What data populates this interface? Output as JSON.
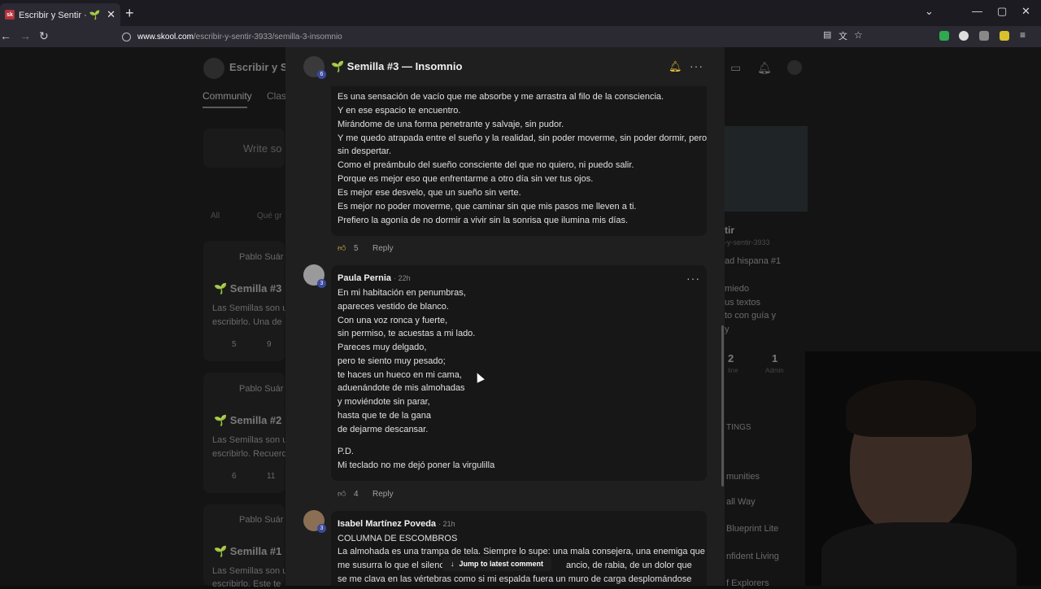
{
  "browser": {
    "tab_title": "Escribir y Sentir · 🌱 | Semillas",
    "tab_favicon": "sk",
    "url_domain": "www.skool.com",
    "url_path": "/escribir-y-sentir-3933/semilla-3-insomnio"
  },
  "background": {
    "community_name": "Escribir y Se",
    "tab_community": "Community",
    "tab_classroom": "Clas",
    "write_placeholder": "Write so",
    "filter_all": "All",
    "filter_other": "Qué gr",
    "posts": [
      {
        "author": "Pablo Suár",
        "title": "🌱 Semilla #3",
        "excerpt1": "Las Semillas son u",
        "excerpt2": "escribirlo. Una de",
        "likes": "5",
        "comments": "9"
      },
      {
        "author": "Pablo Suár",
        "title": "🌱 Semilla #2",
        "excerpt1": "Las Semillas son u",
        "excerpt2": "escribirlo. Recuerd",
        "likes": "6",
        "comments": "11"
      },
      {
        "author": "Pablo Suár",
        "title": "🌱 Semilla #1",
        "excerpt1": "Las Semillas son u",
        "excerpt2": "escribirlo. Este te"
      }
    ],
    "right": {
      "name": "tir",
      "url": "-y-sentir-3933",
      "line1": "ad hispana #1",
      "line2": "miedo",
      "line3": "us textos",
      "line4": "to con guía y",
      "line5": "y",
      "stat1": "2",
      "stat1_label": "line",
      "stat2": "1",
      "stat2_label": "Admin",
      "settings": "TINGS",
      "communities": "munities",
      "c1": "all Way",
      "c2": "Blueprint Lite",
      "c3": "nfident Living",
      "c4": "f Explorers"
    }
  },
  "modal": {
    "title": "🌱 Semilla #3 — Insomnio",
    "poster_level": "6",
    "first_comment": {
      "lines": [
        "Es una sensación de vacío que me absorbe y me arrastra al filo de la consciencia.",
        "Y en ese espacio te encuentro.",
        "Mirándome de una forma penetrante y salvaje, sin pudor.",
        "Y me quedo atrapada entre el sueño y la realidad, sin poder moverme, sin poder dormir, pero",
        "sin despertar.",
        "Como el preámbulo del sueño consciente del que no quiero, ni puedo salir.",
        "Porque es mejor eso que enfrentarme a otro día sin ver tus ojos.",
        "Es mejor ese desvelo, que un sueño sin verte.",
        "Es mejor no poder moverme, que caminar sin que mis pasos me lleven a ti.",
        "Prefiero la agonía de no dormir a vivir sin la sonrisa que ilumina mis días."
      ],
      "likes": "5",
      "reply": "Reply"
    },
    "second_comment": {
      "author": "Paula Pernia",
      "time": "· 22h",
      "level": "3",
      "lines": [
        "En mi habitación en penumbras,",
        "apareces vestido de blanco.",
        "Con una voz ronca y fuerte,",
        "sin permiso, te acuestas a mi lado.",
        "Pareces muy delgado,",
        "pero te siento muy pesado;",
        "te haces un hueco en mi cama,",
        "aduenándote de mis almohadas",
        "y moviéndote sin parar,",
        "hasta que te de la gana",
        "de dejarme descansar."
      ],
      "pd": "P.D.",
      "pd_line": "Mi teclado no me dejó poner la virgulilla",
      "likes": "4",
      "reply": "Reply"
    },
    "third_comment": {
      "author": "Isabel Martínez Poveda",
      "time": "· 21h",
      "level": "3",
      "heading": "COLUMNA DE ESCOMBROS",
      "line1_a": "La almohada es una trampa de tela. Siempre lo supe: una mala consejera, una enemiga que",
      "line2_a": "me susurra lo que el silencio",
      "line2_b": "ancio, de rabia, de un dolor que",
      "line3": "se me clava en las vértebras como si mi espalda fuera un muro de carga desplomándose"
    },
    "jump_label": "Jump to latest comment"
  },
  "colors": {
    "accent": "#e6c13b",
    "level_badge": "#3b4a9c"
  }
}
